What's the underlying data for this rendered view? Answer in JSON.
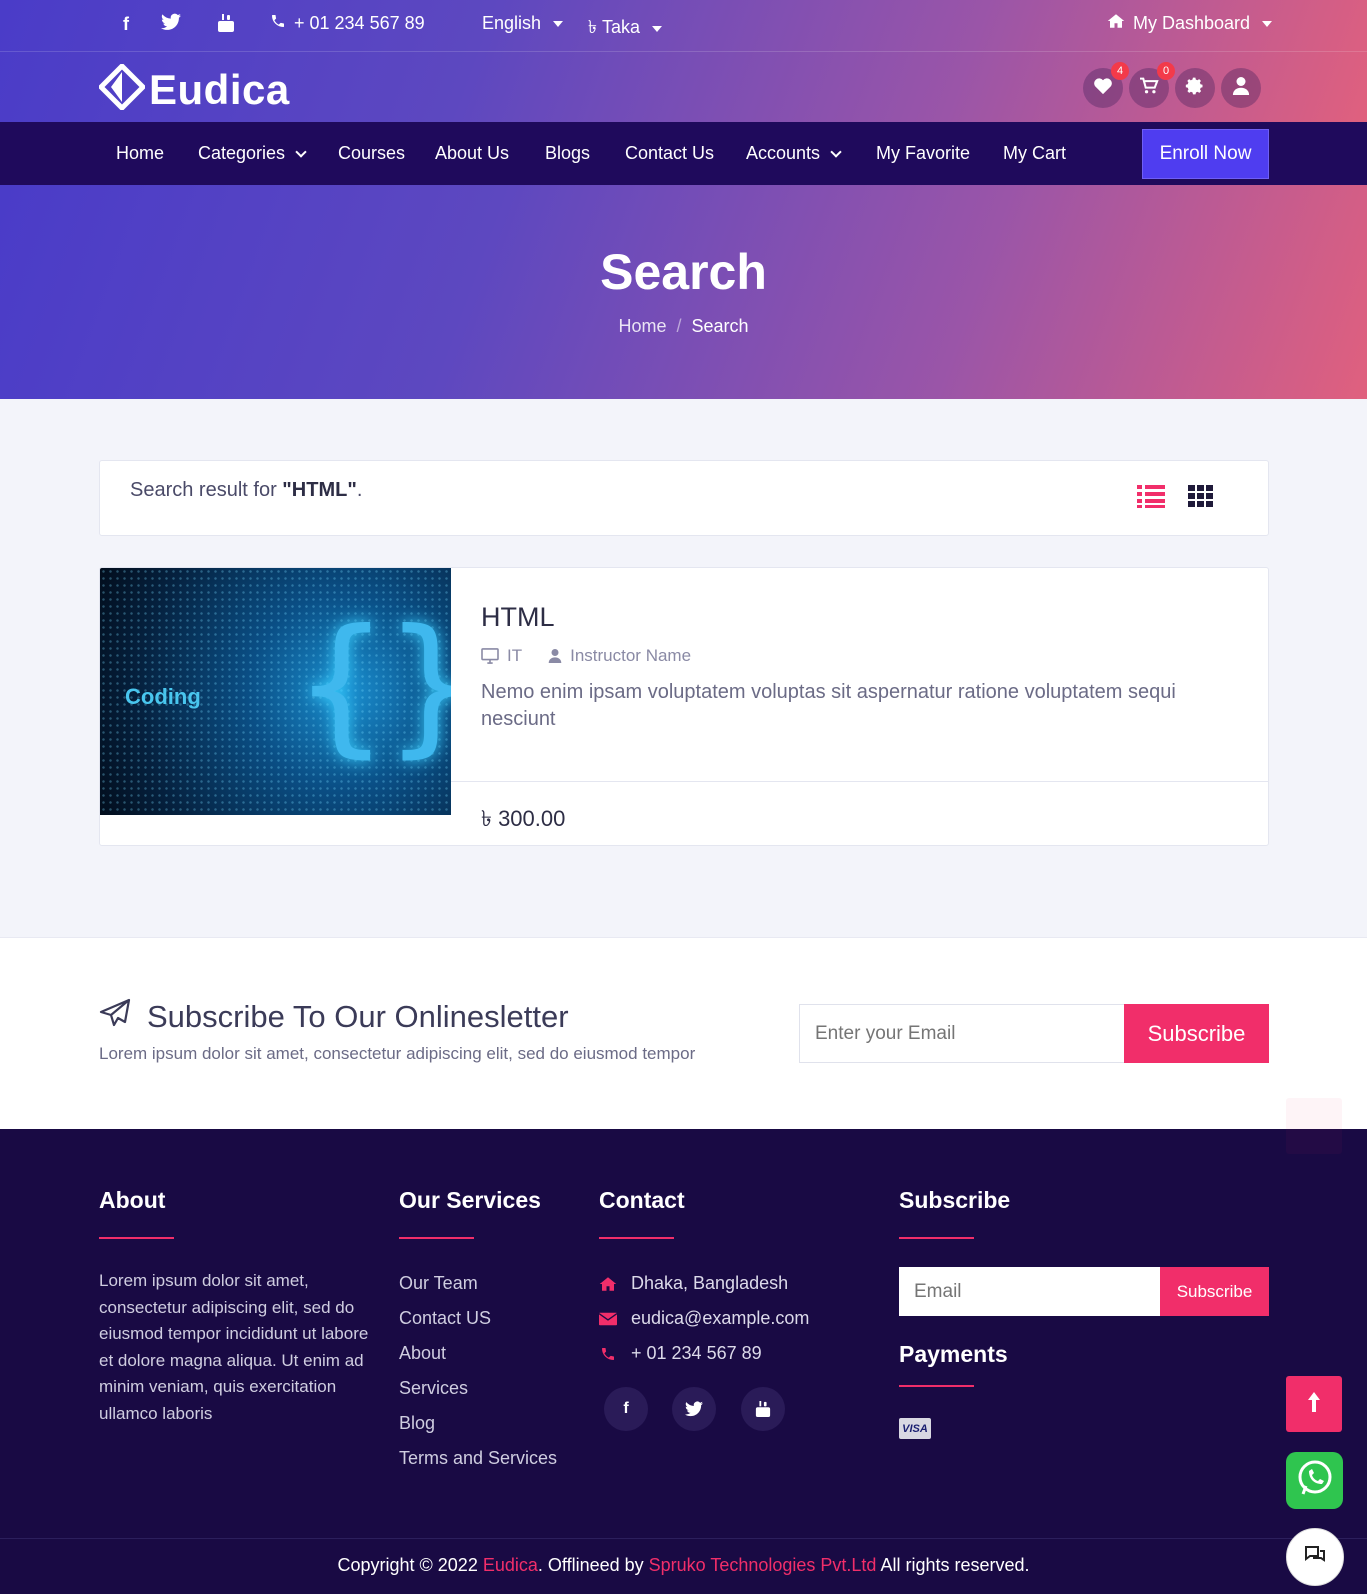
{
  "topbar": {
    "phone": "+ 01 234 567 89",
    "language": "English",
    "currency": "৳ Taka",
    "dashboard": "My Dashboard"
  },
  "brand": {
    "name": "Eudica"
  },
  "header_icons": {
    "wishlist_count": "4",
    "cart_count": "0"
  },
  "nav": {
    "items": [
      "Home",
      "Categories",
      "Courses",
      "About Us",
      "Blogs",
      "Contact Us",
      "Accounts",
      "My Favorite",
      "My Cart"
    ],
    "cta": "Enroll Now"
  },
  "hero": {
    "title": "Search",
    "breadcrumb": [
      "Home",
      "Search"
    ]
  },
  "search": {
    "prefix": "Search result for ",
    "query": "\"HTML\"",
    "suffix": "."
  },
  "course": {
    "thumb_label": "Coding",
    "title": "HTML",
    "category": "IT",
    "instructor": "Instructor Name",
    "description": "Nemo enim ipsam voluptatem voluptas sit aspernatur ratione voluptatem sequi nesciunt",
    "price": "৳ 300.00"
  },
  "newsletter": {
    "title": "Subscribe To Our Onlinesletter",
    "subtitle": "Lorem ipsum dolor sit amet, consectetur adipiscing elit, sed do eiusmod tempor",
    "placeholder": "Enter your Email",
    "button": "Subscribe"
  },
  "footer": {
    "about_title": "About",
    "about_text": "Lorem ipsum dolor sit amet, consectetur adipiscing elit, sed do eiusmod tempor incididunt ut labore et dolore magna aliqua. Ut enim ad minim veniam, quis exercitation ullamco laboris",
    "services_title": "Our Services",
    "services": [
      "Our Team",
      "Contact US",
      "About",
      "Services",
      "Blog",
      "Terms and Services"
    ],
    "contact_title": "Contact",
    "address": "Dhaka, Bangladesh",
    "email": "eudica@example.com",
    "phone": "+ 01 234 567 89",
    "subscribe_title": "Subscribe",
    "subscribe_placeholder": "Email",
    "subscribe_button": "Subscribe",
    "payments_title": "Payments",
    "visa": "VISA",
    "copyright_prefix": "Copyright © 2022 ",
    "copyright_brand": "Eudica",
    "copyright_mid": ". Offlineed by ",
    "copyright_company": "Spruko Technologies Pvt.Ltd",
    "copyright_suffix": " All rights reserved."
  },
  "colors": {
    "accent": "#f12e6a",
    "nav_bg": "#1f0a5c",
    "footer_bg": "#190a44",
    "cta": "#4f3df0"
  }
}
